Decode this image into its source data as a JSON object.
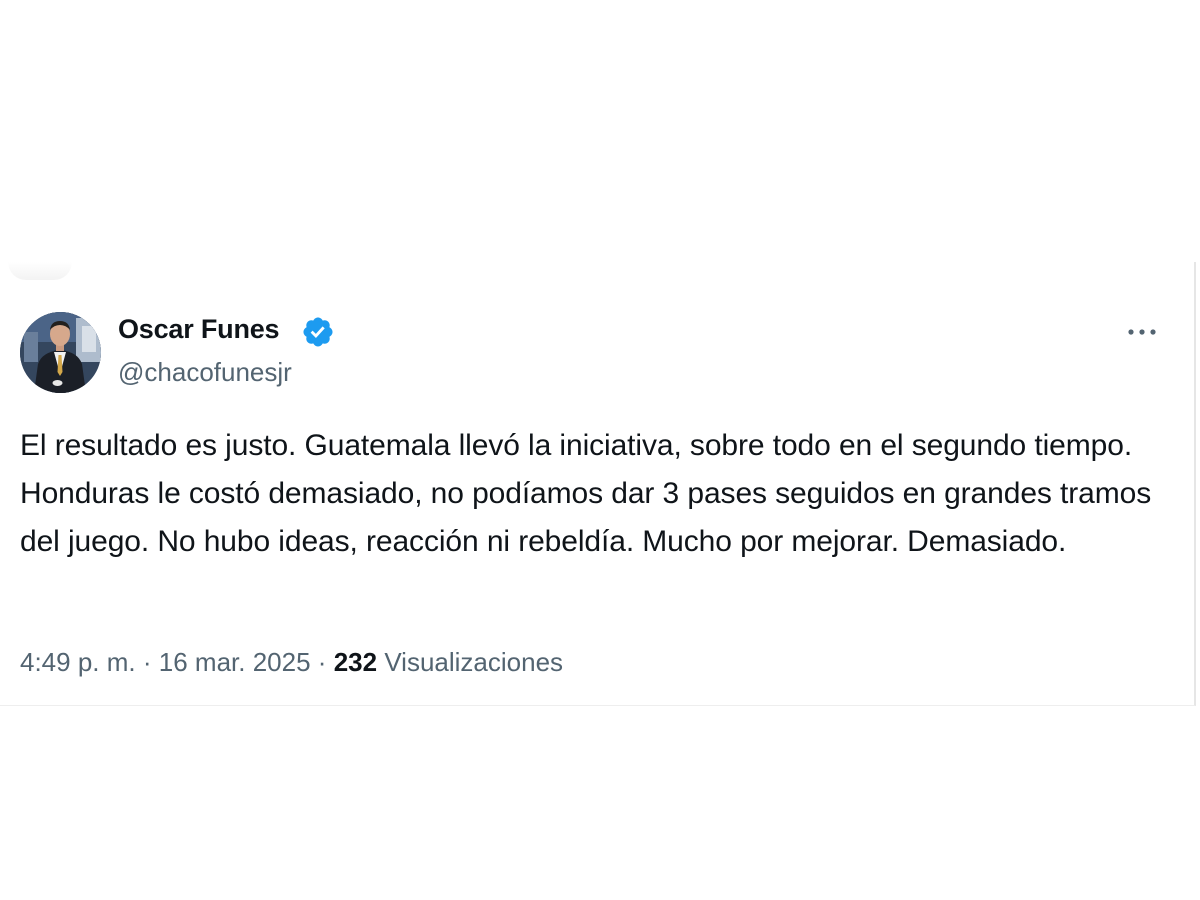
{
  "author": {
    "display_name": "Oscar Funes",
    "handle": "@chacofunesjr",
    "verified": true
  },
  "tweet": {
    "text": "El resultado es justo. Guatemala llevó la iniciativa, sobre todo en el segundo tiempo. Honduras le costó demasiado, no podíamos dar 3 pases seguidos en grandes tramos del juego. No hubo ideas, reacción ni rebeldía. Mucho por mejorar. Demasiado.",
    "time": "4:49 p. m.",
    "separator": "·",
    "date": "16 mar. 2025",
    "views_count": "232",
    "views_label": "Visualizaciones"
  },
  "icons": {
    "verified": "verified-badge-icon",
    "more": "more-options-icon"
  },
  "colors": {
    "verified_blue": "#1d9bf0",
    "text_primary": "#0f1419",
    "text_secondary": "#536471"
  }
}
